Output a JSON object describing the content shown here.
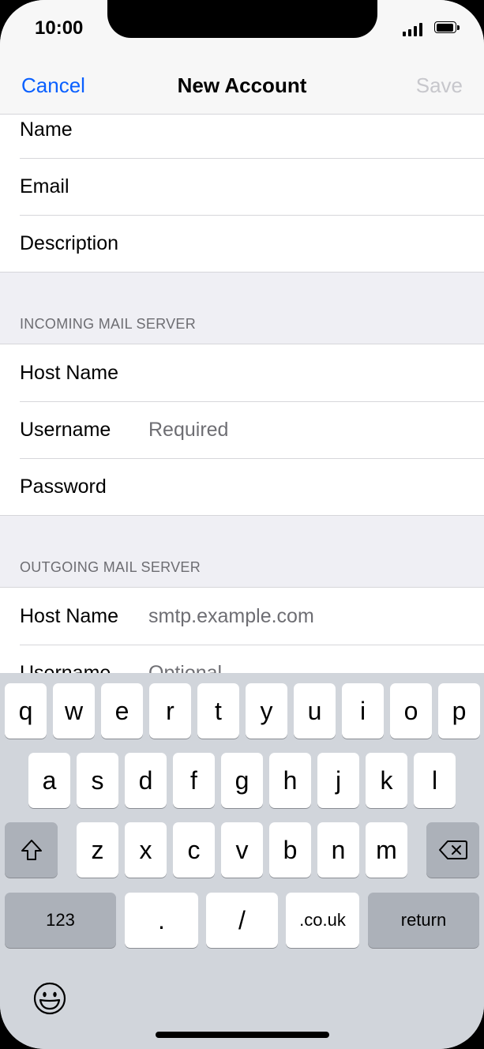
{
  "status": {
    "time": "10:00"
  },
  "nav": {
    "cancel": "Cancel",
    "title": "New Account",
    "save": "Save"
  },
  "account": {
    "name_label": "Name",
    "email_label": "Email",
    "description_label": "Description"
  },
  "incoming": {
    "header": "INCOMING MAIL SERVER",
    "host_label": "Host Name",
    "username_label": "Username",
    "username_placeholder": "Required",
    "password_label": "Password"
  },
  "outgoing": {
    "header": "OUTGOING MAIL SERVER",
    "host_label": "Host Name",
    "host_placeholder": "smtp.example.com",
    "username_label": "Username",
    "username_placeholder": "Optional"
  },
  "keyboard": {
    "row1": [
      "q",
      "w",
      "e",
      "r",
      "t",
      "y",
      "u",
      "i",
      "o",
      "p"
    ],
    "row2": [
      "a",
      "s",
      "d",
      "f",
      "g",
      "h",
      "j",
      "k",
      "l"
    ],
    "row3": [
      "z",
      "x",
      "c",
      "v",
      "b",
      "n",
      "m"
    ],
    "numbers": "123",
    "dot": ".",
    "slash": "/",
    "domain": ".co.uk",
    "return": "return",
    "icons": {
      "shift": "shift-icon",
      "delete": "delete-icon",
      "emoji": "emoji-icon"
    }
  },
  "colors": {
    "accent": "#0a60ff",
    "disabled": "#c7c7cc",
    "background": "#efeff4"
  }
}
